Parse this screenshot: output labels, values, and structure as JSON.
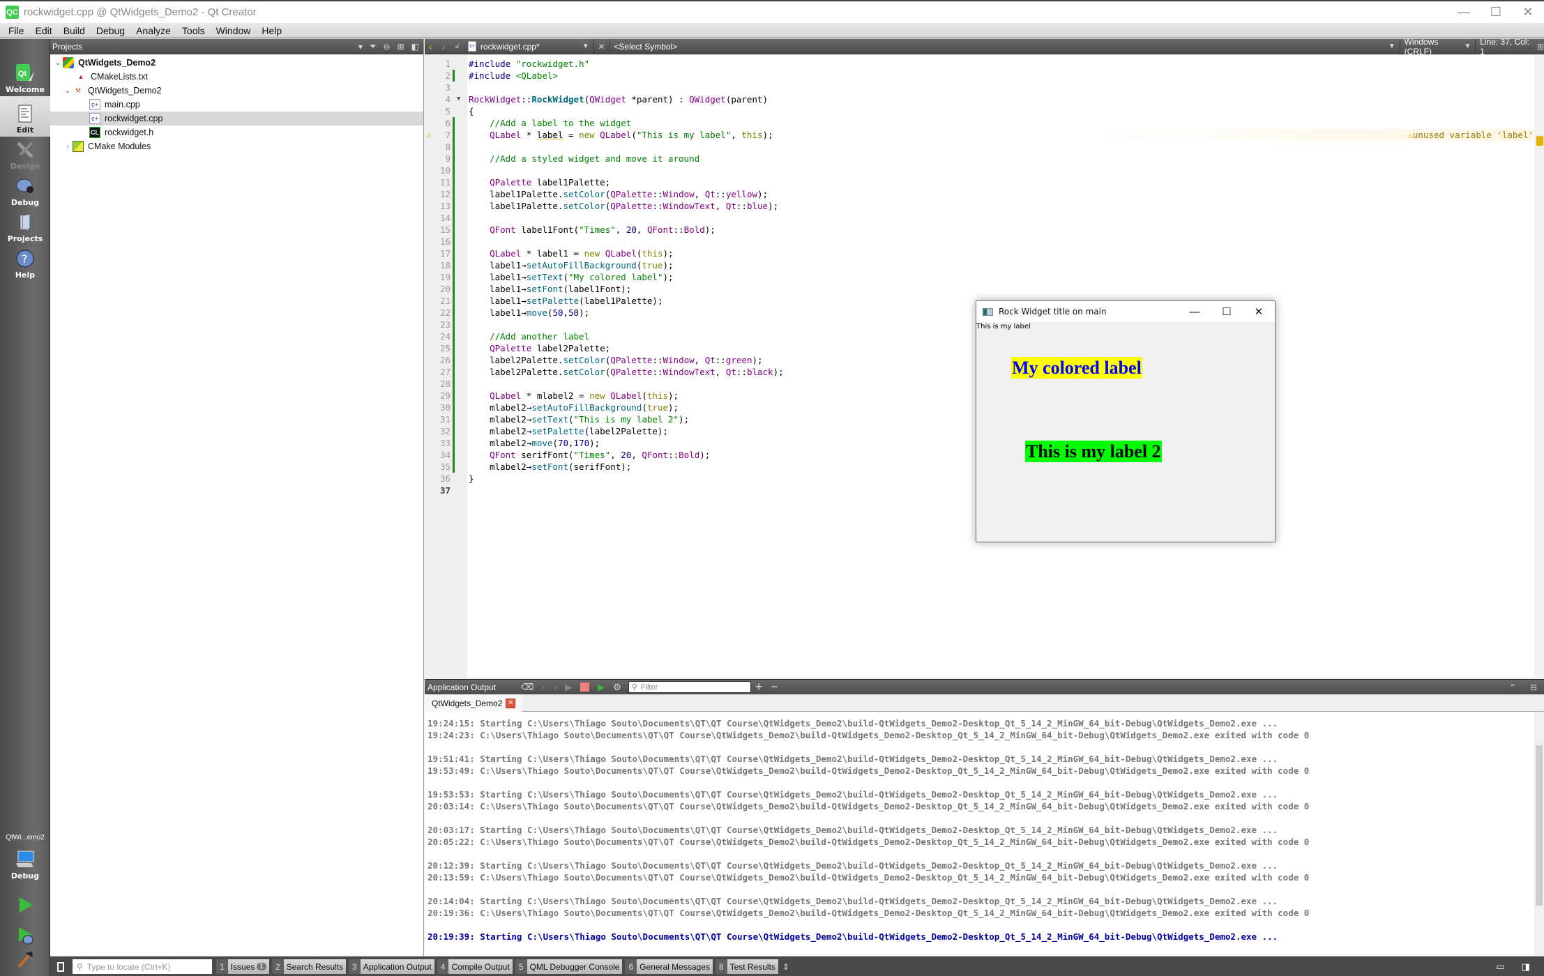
{
  "window": {
    "title": "rockwidget.cpp @ QtWidgets_Demo2 - Qt Creator",
    "app_icon_text": "QC",
    "controls": {
      "minimize": "—",
      "maximize": "☐",
      "close": "✕"
    }
  },
  "menu": [
    "File",
    "Edit",
    "Build",
    "Debug",
    "Analyze",
    "Tools",
    "Window",
    "Help"
  ],
  "modes": [
    {
      "label": "Welcome",
      "icon": "qt-logo-icon"
    },
    {
      "label": "Edit",
      "icon": "document-icon",
      "active": true
    },
    {
      "label": "Design",
      "icon": "design-tools-icon",
      "disabled": true
    },
    {
      "label": "Debug",
      "icon": "bug-icon"
    },
    {
      "label": "Projects",
      "icon": "folder-icon"
    },
    {
      "label": "Help",
      "icon": "help-icon"
    }
  ],
  "kit": {
    "name": "QtWi...emo2",
    "build": "Debug"
  },
  "projects_pane": {
    "title": "Projects",
    "tree": [
      {
        "label": "QtWidgets_Demo2",
        "level": 0,
        "expanded": true,
        "bold": true,
        "icon": "cmake-project-icon"
      },
      {
        "label": "CMakeLists.txt",
        "level": 1,
        "icon": "cmake-file-icon"
      },
      {
        "label": "QtWidgets_Demo2",
        "level": 1,
        "expanded": true,
        "icon": "hammer-icon"
      },
      {
        "label": "main.cpp",
        "level": 2,
        "icon": "cpp-file-icon"
      },
      {
        "label": "rockwidget.cpp",
        "level": 2,
        "icon": "cpp-file-icon",
        "selected": true
      },
      {
        "label": "rockwidget.h",
        "level": 2,
        "icon": "header-file-icon"
      },
      {
        "label": "CMake Modules",
        "level": 1,
        "expanded": false,
        "icon": "cmake-modules-icon"
      }
    ]
  },
  "editor_toolbar": {
    "file": "rockwidget.cpp*",
    "symbol": "<Select Symbol>",
    "line_ending": "Windows (CRLF)",
    "position": "Line: 37, Col: 1"
  },
  "editor": {
    "current_line": 37,
    "warning": {
      "line": 7,
      "message": "unused variable 'label'"
    },
    "lines": [
      {
        "n": "1",
        "html": "<span class=\"pp\">#include</span> <span class=\"str\">\"rockwidget.h\"</span>"
      },
      {
        "n": "2",
        "html": "<span class=\"pp\">#include</span> <span class=\"str\">&lt;QLabel&gt;</span>",
        "mod": true
      },
      {
        "n": "3",
        "html": ""
      },
      {
        "n": "4",
        "html": "<span class=\"ty\">RockWidget</span>::<span class=\"fnb\">RockWidget</span>(<span class=\"ty\">QWidget</span> *parent) : <span class=\"ty\">QWidget</span>(parent)",
        "fold": true
      },
      {
        "n": "5",
        "html": "{"
      },
      {
        "n": "6",
        "html": "    <span class=\"cm\">//Add a label to the widget</span>",
        "mod": true
      },
      {
        "n": "7",
        "html": "    <span class=\"ty\">QLabel</span> * <span class=\"und\">label</span> = <span class=\"kw\">new</span> <span class=\"ty\">QLabel</span>(<span class=\"str\">\"This is my label\"</span>, <span class=\"kw\">this</span>);",
        "mod": true,
        "warn": true
      },
      {
        "n": "8",
        "html": "",
        "mod": true
      },
      {
        "n": "9",
        "html": "    <span class=\"cm\">//Add a styled widget and move it around</span>",
        "mod": true
      },
      {
        "n": "10",
        "html": "",
        "mod": true
      },
      {
        "n": "11",
        "html": "    <span class=\"ty\">QPalette</span> label1Palette;",
        "mod": true
      },
      {
        "n": "12",
        "html": "    label1Palette.<span class=\"fn\">setColor</span>(<span class=\"ty\">QPalette</span>::<span class=\"en\">Window</span>, <span class=\"ty\">Qt</span>::<span class=\"en\">yellow</span>);",
        "mod": true
      },
      {
        "n": "13",
        "html": "    label1Palette.<span class=\"fn\">setColor</span>(<span class=\"ty\">QPalette</span>::<span class=\"en\">WindowText</span>, <span class=\"ty\">Qt</span>::<span class=\"en\">blue</span>);",
        "mod": true
      },
      {
        "n": "14",
        "html": "",
        "mod": true
      },
      {
        "n": "15",
        "html": "    <span class=\"ty\">QFont</span> label1Font(<span class=\"str\">\"Times\"</span>, <span class=\"num2\">20</span>, <span class=\"ty\">QFont</span>::<span class=\"en\">Bold</span>);",
        "mod": true
      },
      {
        "n": "16",
        "html": "",
        "mod": true
      },
      {
        "n": "17",
        "html": "    <span class=\"ty\">QLabel</span> * label1 = <span class=\"kw\">new</span> <span class=\"ty\">QLabel</span>(<span class=\"kw\">this</span>);",
        "mod": true
      },
      {
        "n": "18",
        "html": "    label1→<span class=\"fn\">setAutoFillBackground</span>(<span class=\"kw\">true</span>);",
        "mod": true
      },
      {
        "n": "19",
        "html": "    label1→<span class=\"fn\">setText</span>(<span class=\"str\">\"My colored label\"</span>);",
        "mod": true
      },
      {
        "n": "20",
        "html": "    label1→<span class=\"fn\">setFont</span>(label1Font);",
        "mod": true
      },
      {
        "n": "21",
        "html": "    label1→<span class=\"fn\">setPalette</span>(label1Palette);",
        "mod": true
      },
      {
        "n": "22",
        "html": "    label1→<span class=\"fn\">move</span>(<span class=\"num2\">50</span>,<span class=\"num2\">50</span>);",
        "mod": true
      },
      {
        "n": "23",
        "html": "",
        "mod": true
      },
      {
        "n": "24",
        "html": "    <span class=\"cm\">//Add another label</span>",
        "mod": true
      },
      {
        "n": "25",
        "html": "    <span class=\"ty\">QPalette</span> label2Palette;",
        "mod": true
      },
      {
        "n": "26",
        "html": "    label2Palette.<span class=\"fn\">setColor</span>(<span class=\"ty\">QPalette</span>::<span class=\"en\">Window</span>, <span class=\"ty\">Qt</span>::<span class=\"en\">green</span>);",
        "mod": true
      },
      {
        "n": "27",
        "html": "    label2Palette.<span class=\"fn\">setColor</span>(<span class=\"ty\">QPalette</span>::<span class=\"en\">WindowText</span>, <span class=\"ty\">Qt</span>::<span class=\"en\">black</span>);",
        "mod": true
      },
      {
        "n": "28",
        "html": "",
        "mod": true
      },
      {
        "n": "29",
        "html": "    <span class=\"ty\">QLabel</span> * mlabel2 = <span class=\"kw\">new</span> <span class=\"ty\">QLabel</span>(<span class=\"kw\">this</span>);",
        "mod": true
      },
      {
        "n": "30",
        "html": "    mlabel2→<span class=\"fn\">setAutoFillBackground</span>(<span class=\"kw\">true</span>);",
        "mod": true
      },
      {
        "n": "31",
        "html": "    mlabel2→<span class=\"fn\">setText</span>(<span class=\"str\">\"This is my label 2\"</span>);",
        "mod": true
      },
      {
        "n": "32",
        "html": "    mlabel2→<span class=\"fn\">setPalette</span>(label2Palette);",
        "mod": true
      },
      {
        "n": "33",
        "html": "    mlabel2→<span class=\"fn\">move</span>(<span class=\"num2\">70</span>,<span class=\"num2\">170</span>);",
        "mod": true
      },
      {
        "n": "34",
        "html": "    <span class=\"ty\">QFont</span> serifFont(<span class=\"str\">\"Times\"</span>, <span class=\"num2\">20</span>, <span class=\"ty\">QFont</span>::<span class=\"en\">Bold</span>);",
        "mod": true
      },
      {
        "n": "35",
        "html": "    mlabel2→<span class=\"fn\">setFont</span>(serifFont);",
        "mod": true
      },
      {
        "n": "36",
        "html": "}"
      },
      {
        "n": "37",
        "html": ""
      }
    ]
  },
  "output_pane": {
    "title": "Application Output",
    "filter_placeholder": "Filter",
    "tab": "QtWidgets_Demo2",
    "lines": [
      "19:24:15: Starting C:\\Users\\Thiago Souto\\Documents\\QT\\QT Course\\QtWidgets_Demo2\\build-QtWidgets_Demo2-Desktop_Qt_5_14_2_MinGW_64_bit-Debug\\QtWidgets_Demo2.exe ...",
      "19:24:23: C:\\Users\\Thiago Souto\\Documents\\QT\\QT Course\\QtWidgets_Demo2\\build-QtWidgets_Demo2-Desktop_Qt_5_14_2_MinGW_64_bit-Debug\\QtWidgets_Demo2.exe exited with code 0",
      "",
      "19:51:41: Starting C:\\Users\\Thiago Souto\\Documents\\QT\\QT Course\\QtWidgets_Demo2\\build-QtWidgets_Demo2-Desktop_Qt_5_14_2_MinGW_64_bit-Debug\\QtWidgets_Demo2.exe ...",
      "19:53:49: C:\\Users\\Thiago Souto\\Documents\\QT\\QT Course\\QtWidgets_Demo2\\build-QtWidgets_Demo2-Desktop_Qt_5_14_2_MinGW_64_bit-Debug\\QtWidgets_Demo2.exe exited with code 0",
      "",
      "19:53:53: Starting C:\\Users\\Thiago Souto\\Documents\\QT\\QT Course\\QtWidgets_Demo2\\build-QtWidgets_Demo2-Desktop_Qt_5_14_2_MinGW_64_bit-Debug\\QtWidgets_Demo2.exe ...",
      "20:03:14: C:\\Users\\Thiago Souto\\Documents\\QT\\QT Course\\QtWidgets_Demo2\\build-QtWidgets_Demo2-Desktop_Qt_5_14_2_MinGW_64_bit-Debug\\QtWidgets_Demo2.exe exited with code 0",
      "",
      "20:03:17: Starting C:\\Users\\Thiago Souto\\Documents\\QT\\QT Course\\QtWidgets_Demo2\\build-QtWidgets_Demo2-Desktop_Qt_5_14_2_MinGW_64_bit-Debug\\QtWidgets_Demo2.exe ...",
      "20:05:22: C:\\Users\\Thiago Souto\\Documents\\QT\\QT Course\\QtWidgets_Demo2\\build-QtWidgets_Demo2-Desktop_Qt_5_14_2_MinGW_64_bit-Debug\\QtWidgets_Demo2.exe exited with code 0",
      "",
      "20:12:39: Starting C:\\Users\\Thiago Souto\\Documents\\QT\\QT Course\\QtWidgets_Demo2\\build-QtWidgets_Demo2-Desktop_Qt_5_14_2_MinGW_64_bit-Debug\\QtWidgets_Demo2.exe ...",
      "20:13:59: C:\\Users\\Thiago Souto\\Documents\\QT\\QT Course\\QtWidgets_Demo2\\build-QtWidgets_Demo2-Desktop_Qt_5_14_2_MinGW_64_bit-Debug\\QtWidgets_Demo2.exe exited with code 0",
      "",
      "20:14:04: Starting C:\\Users\\Thiago Souto\\Documents\\QT\\QT Course\\QtWidgets_Demo2\\build-QtWidgets_Demo2-Desktop_Qt_5_14_2_MinGW_64_bit-Debug\\QtWidgets_Demo2.exe ...",
      "20:19:36: C:\\Users\\Thiago Souto\\Documents\\QT\\QT Course\\QtWidgets_Demo2\\build-QtWidgets_Demo2-Desktop_Qt_5_14_2_MinGW_64_bit-Debug\\QtWidgets_Demo2.exe exited with code 0",
      ""
    ],
    "current_line": "20:19:39: Starting C:\\Users\\Thiago Souto\\Documents\\QT\\QT Course\\QtWidgets_Demo2\\build-QtWidgets_Demo2-Desktop_Qt_5_14_2_MinGW_64_bit-Debug\\QtWidgets_Demo2.exe ..."
  },
  "statusbar": {
    "locator_placeholder": "Type to locate (Ctrl+K)",
    "panes": [
      {
        "n": "1",
        "label": "Issues",
        "badge": "1"
      },
      {
        "n": "2",
        "label": "Search Results"
      },
      {
        "n": "3",
        "label": "Application Output"
      },
      {
        "n": "4",
        "label": "Compile Output"
      },
      {
        "n": "5",
        "label": "QML Debugger Console"
      },
      {
        "n": "6",
        "label": "General Messages"
      },
      {
        "n": "8",
        "label": "Test Results"
      }
    ]
  },
  "rock_widget": {
    "title": "Rock Widget title on main",
    "plain_label": "This is my label",
    "label1": {
      "text": "My colored label",
      "bg": "#ffff00",
      "fg": "#0000ff"
    },
    "label2": {
      "text": "This is my label 2",
      "bg": "#00ff00",
      "fg": "#000000"
    }
  }
}
